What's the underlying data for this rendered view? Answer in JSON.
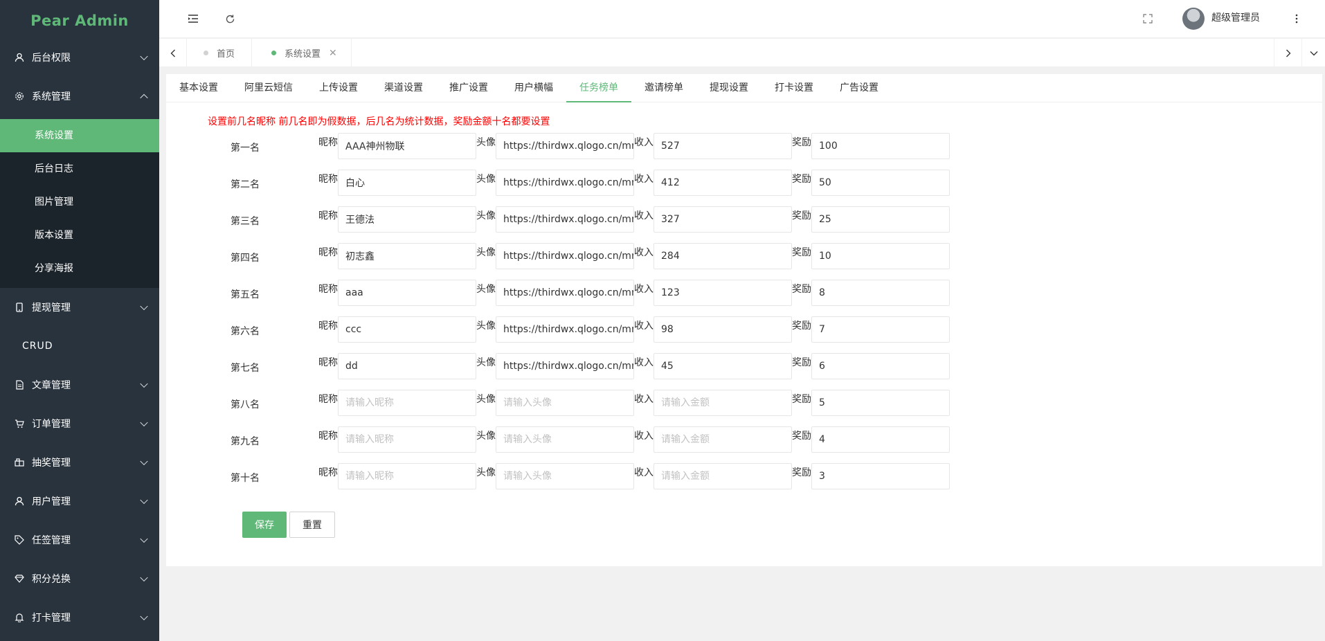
{
  "app": {
    "title": "Pear Admin"
  },
  "sidebar": {
    "menus": [
      {
        "label": "后台权限",
        "icon": "user-icon",
        "expanded": false
      },
      {
        "label": "系统管理",
        "icon": "gear-icon",
        "expanded": true
      },
      {
        "label": "提现管理",
        "icon": "phone-icon",
        "expanded": false
      },
      {
        "label": "CRUD"
      },
      {
        "label": "文章管理",
        "icon": "document-icon",
        "expanded": false
      },
      {
        "label": "订单管理",
        "icon": "cart-icon",
        "expanded": false
      },
      {
        "label": "抽奖管理",
        "icon": "prize-icon",
        "expanded": false
      },
      {
        "label": "用户管理",
        "icon": "user-icon",
        "expanded": false
      },
      {
        "label": "任签管理",
        "icon": "tag-icon",
        "expanded": false
      },
      {
        "label": "积分兑换",
        "icon": "diamond-icon",
        "expanded": false
      },
      {
        "label": "打卡管理",
        "icon": "bell-icon",
        "expanded": false
      }
    ],
    "system_submenu": [
      "系统设置",
      "后台日志",
      "图片管理",
      "版本设置",
      "分享海报"
    ]
  },
  "header": {
    "user_name": "超级管理员"
  },
  "tabs": [
    {
      "label": "首页",
      "active": false
    },
    {
      "label": "系统设置",
      "active": true
    }
  ],
  "subtabs": [
    "基本设置",
    "阿里云短信",
    "上传设置",
    "渠道设置",
    "推广设置",
    "用户横幅",
    "任务榜单",
    "邀请榜单",
    "提现设置",
    "打卡设置",
    "广告设置"
  ],
  "active_subtab": "任务榜单",
  "notice": "设置前几名昵称 前几名即为假数据，后几名为统计数据，奖励金额十名都要设置",
  "field_labels": {
    "nickname": "昵称",
    "avatar": "头像",
    "income": "收入",
    "reward": "奖励"
  },
  "placeholders": {
    "nickname": "请输入昵称",
    "avatar": "请输入头像",
    "income": "请输入金额"
  },
  "ranks": [
    {
      "label": "第一名",
      "nickname": "AAA神州物联",
      "avatar": "https://thirdwx.qlogo.cn/mmope",
      "income": "527",
      "reward": "100"
    },
    {
      "label": "第二名",
      "nickname": "白心",
      "avatar": "https://thirdwx.qlogo.cn/mmope",
      "income": "412",
      "reward": "50"
    },
    {
      "label": "第三名",
      "nickname": "王德法",
      "avatar": "https://thirdwx.qlogo.cn/mmope",
      "income": "327",
      "reward": "25"
    },
    {
      "label": "第四名",
      "nickname": "初志鑫",
      "avatar": "https://thirdwx.qlogo.cn/mmope",
      "income": "284",
      "reward": "10"
    },
    {
      "label": "第五名",
      "nickname": "aaa",
      "avatar": "https://thirdwx.qlogo.cn/mmope",
      "income": "123",
      "reward": "8"
    },
    {
      "label": "第六名",
      "nickname": "ccc",
      "avatar": "https://thirdwx.qlogo.cn/mmope",
      "income": "98",
      "reward": "7"
    },
    {
      "label": "第七名",
      "nickname": "dd",
      "avatar": "https://thirdwx.qlogo.cn/mmope",
      "income": "45",
      "reward": "6"
    },
    {
      "label": "第八名",
      "nickname": "",
      "avatar": "",
      "income": "",
      "reward": "5"
    },
    {
      "label": "第九名",
      "nickname": "",
      "avatar": "",
      "income": "",
      "reward": "4"
    },
    {
      "label": "第十名",
      "nickname": "",
      "avatar": "",
      "income": "",
      "reward": "3"
    }
  ],
  "buttons": {
    "save": "保存",
    "reset": "重置"
  },
  "colors": {
    "accent": "#5fb878",
    "sidebar_bg": "#28333e",
    "submenu_bg": "#1b232b",
    "notice": "#ff0000"
  }
}
